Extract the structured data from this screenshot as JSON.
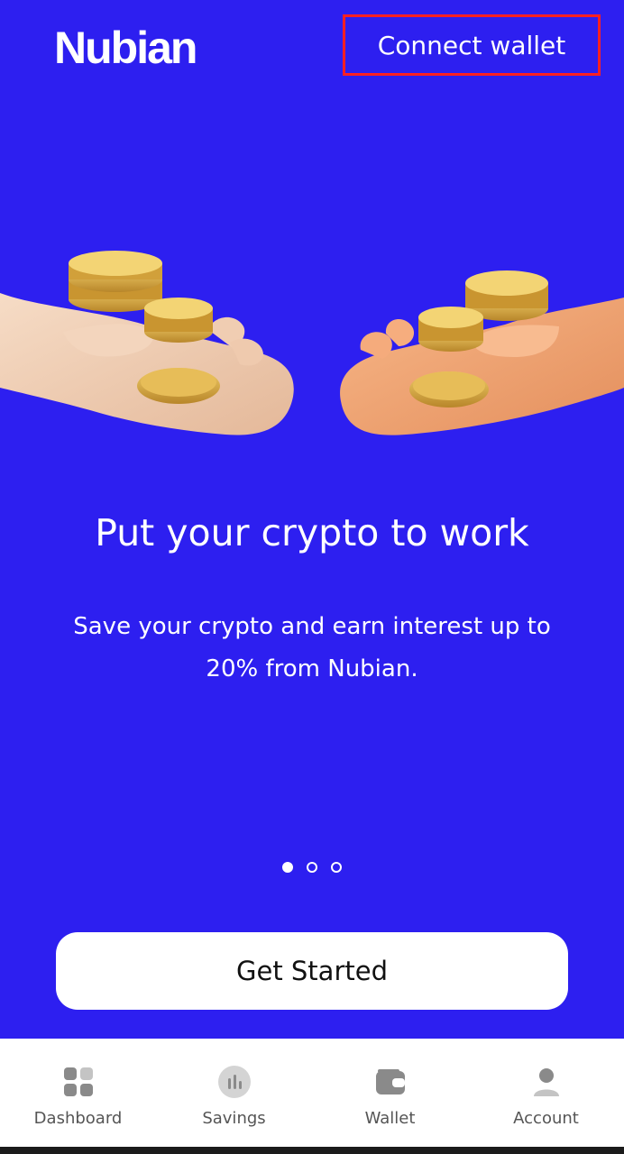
{
  "header": {
    "logo_text": "Nubian",
    "connect_wallet_label": "Connect wallet"
  },
  "hero": {
    "headline": "Put your crypto to work",
    "subtitle": "Save your crypto and earn interest up to 20% from Nubian."
  },
  "pager": {
    "total": 3,
    "active_index": 0
  },
  "cta": {
    "label": "Get Started"
  },
  "bottom_nav": {
    "items": [
      {
        "label": "Dashboard",
        "icon": "dashboard-grid-icon"
      },
      {
        "label": "Savings",
        "icon": "savings-chart-icon"
      },
      {
        "label": "Wallet",
        "icon": "wallet-icon"
      },
      {
        "label": "Account",
        "icon": "account-person-icon"
      }
    ]
  },
  "colors": {
    "background": "#2d1ff0",
    "highlight_border": "#ff2020",
    "nav_icon": "#8a8a8a",
    "coin": "#d9a93a"
  }
}
